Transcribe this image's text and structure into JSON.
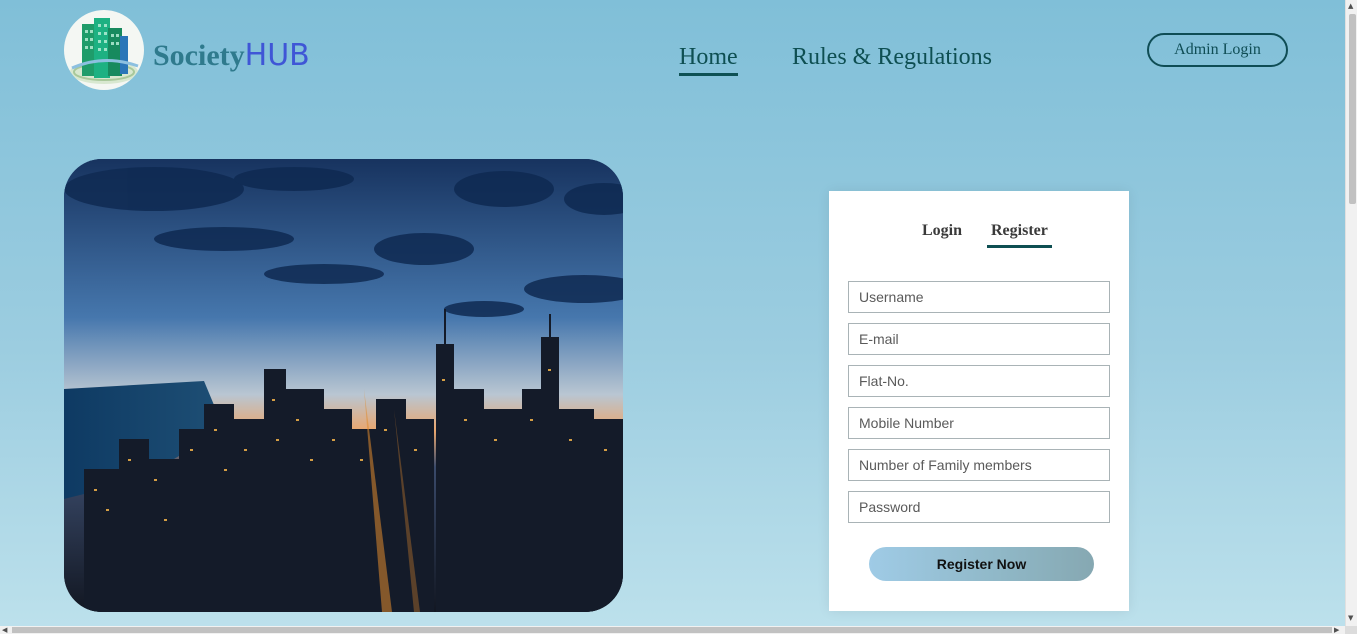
{
  "header": {
    "brand_part1": "Society",
    "brand_part2": "HUB",
    "logo_icon": "building-logo-icon",
    "nav": [
      {
        "label": "Home",
        "active": true
      },
      {
        "label": "Rules & Regulations",
        "active": false
      }
    ],
    "admin_login_label": "Admin Login"
  },
  "hero": {
    "image": "city-skyline-at-dusk"
  },
  "form": {
    "tabs": [
      {
        "label": "Login",
        "active": false
      },
      {
        "label": "Register",
        "active": true
      }
    ],
    "fields": [
      {
        "name": "username",
        "placeholder": "Username",
        "value": ""
      },
      {
        "name": "email",
        "placeholder": "E-mail",
        "value": ""
      },
      {
        "name": "flat",
        "placeholder": "Flat-No.",
        "value": ""
      },
      {
        "name": "mobile",
        "placeholder": "Mobile Number",
        "value": ""
      },
      {
        "name": "family",
        "placeholder": "Number of Family members",
        "value": ""
      },
      {
        "name": "password",
        "placeholder": "Password",
        "value": ""
      }
    ],
    "submit_label": "Register Now"
  },
  "colors": {
    "accent": "#0e4f52",
    "brand_teal": "#2f7a8d",
    "brand_blue": "#3f56d6",
    "background_top": "#80bfd8",
    "background_bottom": "#bde1ec"
  }
}
